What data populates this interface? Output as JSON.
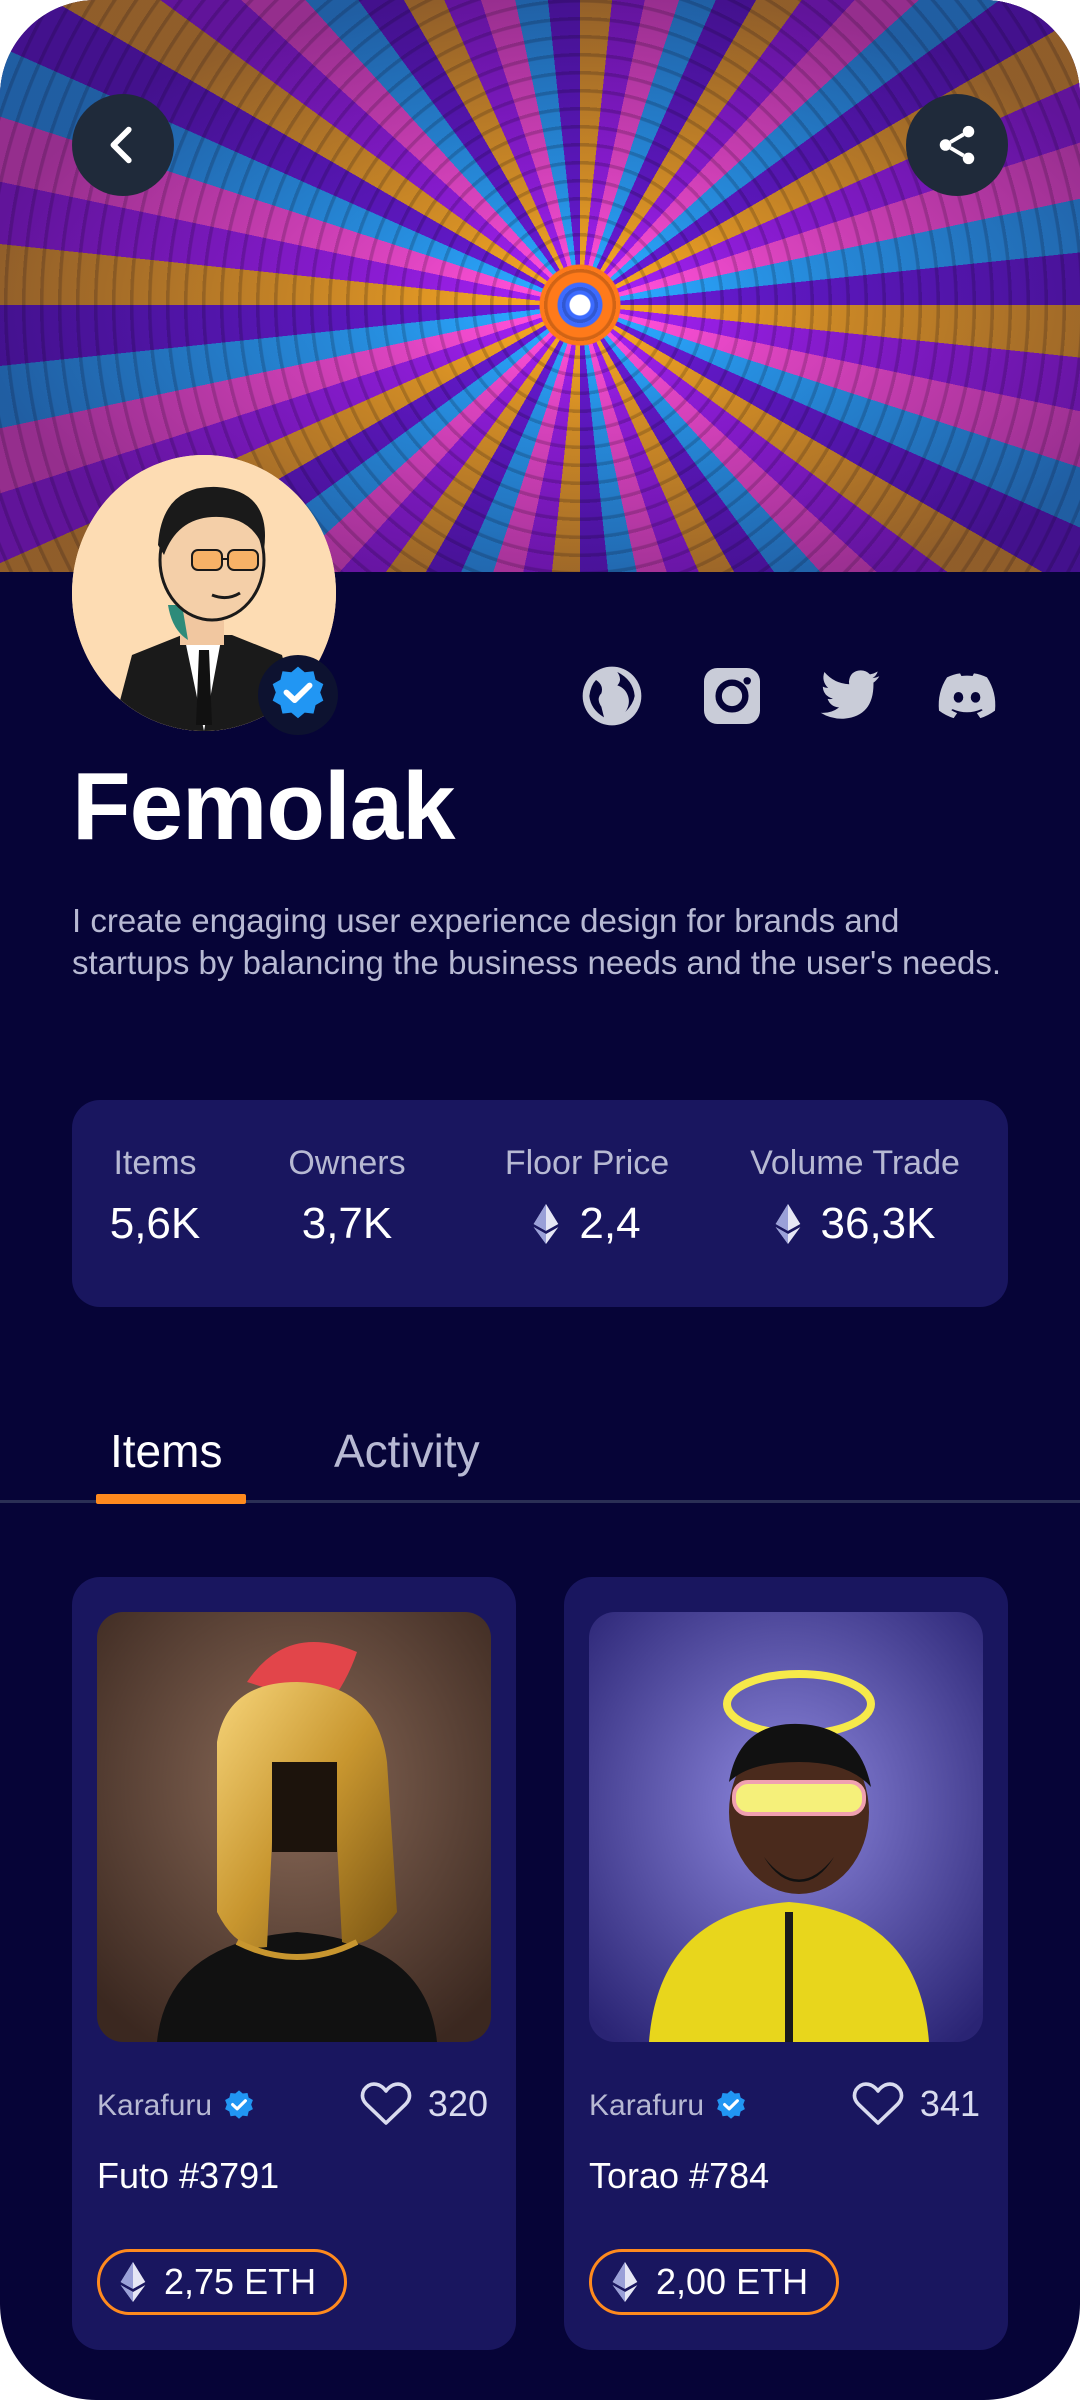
{
  "header": {
    "back_icon": "chevron-left-icon",
    "share_icon": "share-icon"
  },
  "profile": {
    "name": "Femolak",
    "bio": "I create engaging user experience design for brands and startups by balancing the business needs and the user's needs.",
    "verified": true,
    "social_icons": [
      "globe-icon",
      "instagram-icon",
      "twitter-icon",
      "discord-icon"
    ]
  },
  "stats": [
    {
      "label": "Items",
      "value": "5,6K"
    },
    {
      "label": "Owners",
      "value": "3,7K"
    },
    {
      "label": "Floor Price",
      "value": "2,4",
      "icon": "eth-icon"
    },
    {
      "label": "Volume Trade",
      "value": "36,3K",
      "icon": "eth-icon"
    }
  ],
  "tabs": [
    {
      "label": "Items",
      "active": true
    },
    {
      "label": "Activity",
      "active": false
    }
  ],
  "cards": [
    {
      "creator": "Karafuru",
      "likes": "320",
      "title": "Futo #3791",
      "price": "2,75 ETH"
    },
    {
      "creator": "Karafuru",
      "likes": "341",
      "title": "Torao #784",
      "price": "2,00 ETH"
    }
  ],
  "colors": {
    "background": "#060437",
    "panel": "#19165f",
    "accent": "#ff8a1e",
    "verified": "#2196f3"
  }
}
